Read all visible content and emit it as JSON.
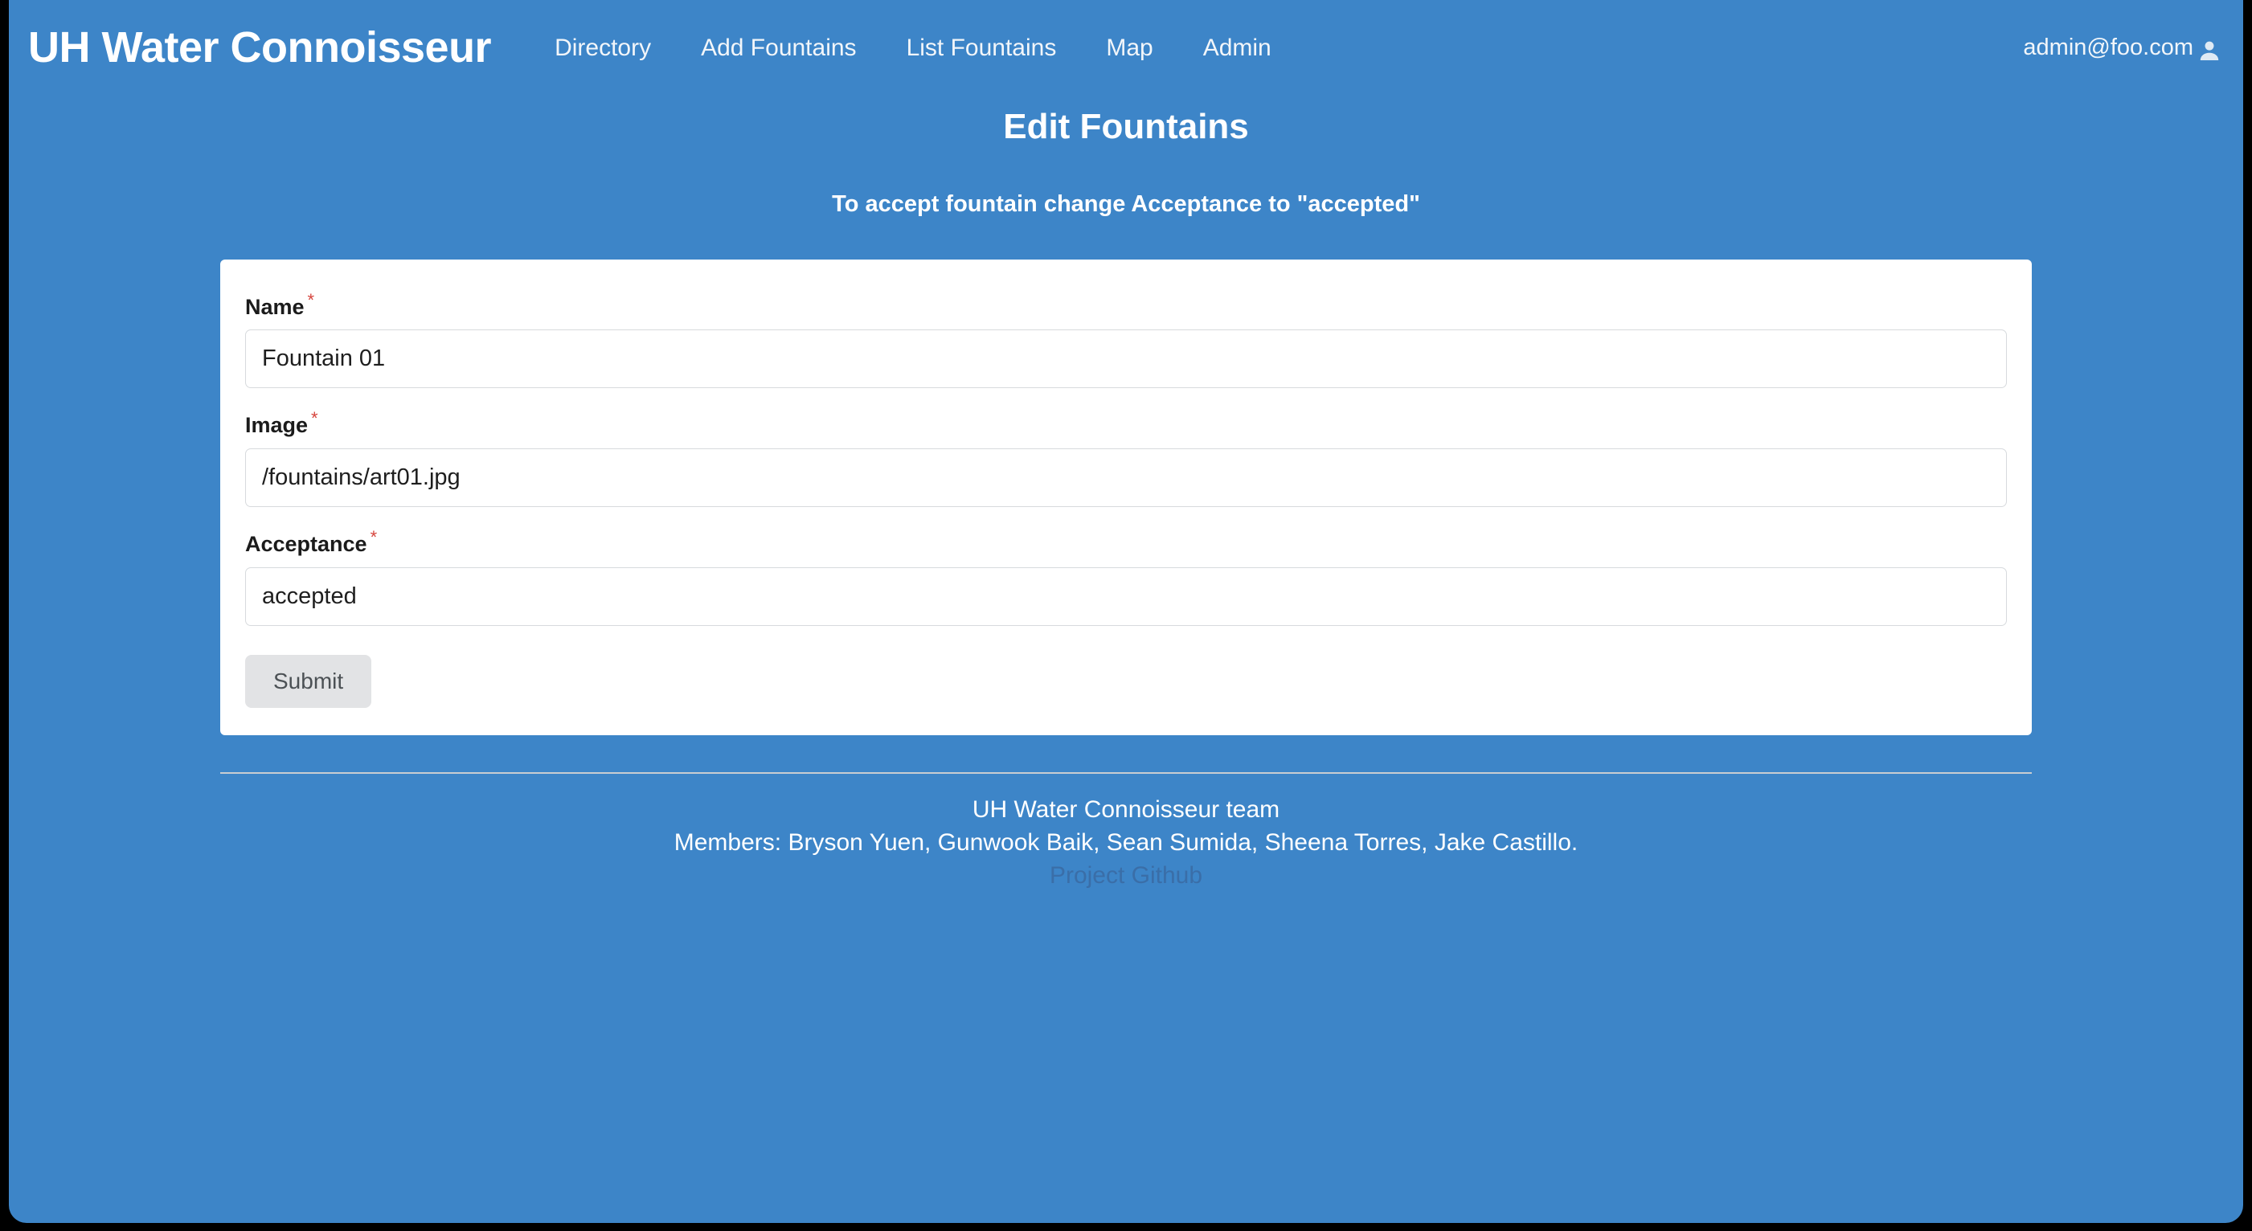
{
  "navbar": {
    "brand": "UH Water Connoisseur",
    "links": [
      {
        "label": "Directory"
      },
      {
        "label": "Add Fountains"
      },
      {
        "label": "List Fountains"
      },
      {
        "label": "Map"
      },
      {
        "label": "Admin"
      }
    ],
    "user": {
      "email": "admin@foo.com",
      "icon": "user-account-icon"
    },
    "background_color": "#3d85c8"
  },
  "header": {
    "title": "Edit Fountains",
    "subtitle": "To accept fountain change Acceptance to \"accepted\""
  },
  "form": {
    "required_marker": "*",
    "required_marker_color": "#d6453d",
    "fields": [
      {
        "label": "Name",
        "value": "Fountain 01",
        "placeholder": "Name"
      },
      {
        "label": "Image",
        "value": "/fountains/art01.jpg",
        "placeholder": "Image"
      },
      {
        "label": "Acceptance",
        "value": "accepted",
        "placeholder": "Acceptance"
      }
    ],
    "submit_label": "Submit"
  },
  "footer": {
    "team_line": "UH Water Connoisseur team",
    "members_line": "Members: Bryson Yuen, Gunwook Baik, Sean Sumida, Sheena Torres, Jake Castillo.",
    "github_link": "Project Github",
    "github_link_color": "#3a6ea8"
  }
}
